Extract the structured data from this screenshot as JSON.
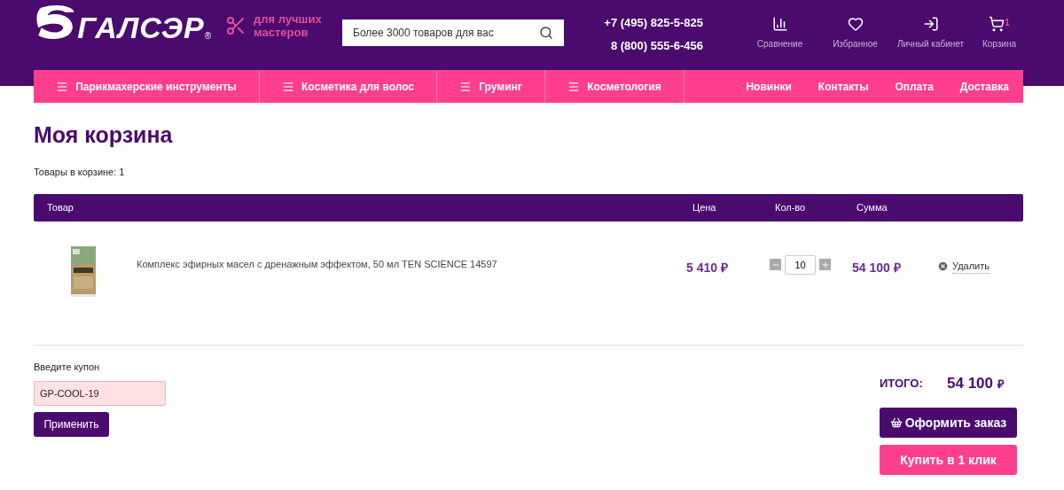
{
  "header": {
    "logo_text": "ГАЛСЭР",
    "logo_mark": "®",
    "tagline": "для лучших мастеров",
    "search": {
      "placeholder": "Более 3000 товаров для вас"
    },
    "phones": [
      "+7 (495) 825-5-825",
      "8 (800) 555-6-456"
    ],
    "actions": [
      {
        "kind": "compare",
        "label": "Сравнение"
      },
      {
        "kind": "favorites",
        "label": "Избранное"
      },
      {
        "kind": "account",
        "label": "Личный кабинет"
      },
      {
        "kind": "cart",
        "label": "Корзина",
        "count": "1"
      }
    ]
  },
  "nav": {
    "categories": [
      "Парикмахерские инструменты",
      "Косметика для волос",
      "Груминг",
      "Косметология"
    ],
    "links": [
      "Новинки",
      "Контакты",
      "Оплата",
      "Доставка"
    ]
  },
  "page_title": "Моя корзина",
  "items_count": "Товары в корзине: 1",
  "table": {
    "columns": [
      "Товар",
      "Цена",
      "Кол-во",
      "Сумма"
    ],
    "rows": [
      {
        "name": "Комплекс эфирных масел с дренажным эффектом, 50 мл TEN SCIENCE 14597",
        "price": "5 410",
        "currency": "₽",
        "quantity": "10",
        "sum": "54 100",
        "sum_currency": "₽",
        "delete": "Удалить"
      }
    ]
  },
  "coupon": {
    "label": "Введите купон",
    "value": "GP-COOL-19",
    "apply": "Применить"
  },
  "total": {
    "label": "ИТОГО:",
    "value": "54 100",
    "currency": "₽"
  },
  "buttons": {
    "checkout": "Оформить заказ",
    "one_click": "Купить в 1 клик"
  }
}
